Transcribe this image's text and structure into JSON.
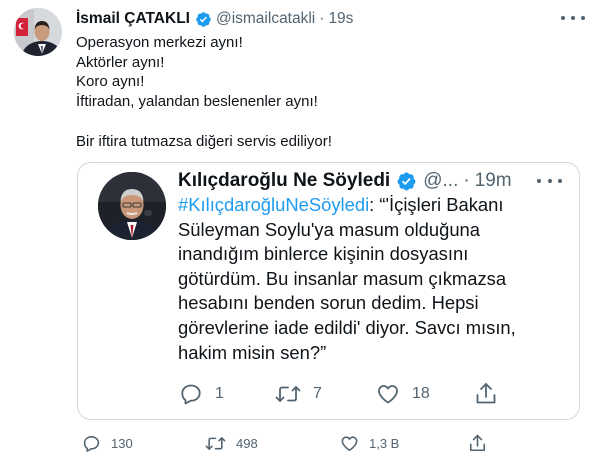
{
  "tweet": {
    "author": {
      "name": "İsmail ÇATAKLI",
      "handle": "@ismailcatakli",
      "verified": true
    },
    "time": "19s",
    "separator": "·",
    "lines": [
      "Operasyon merkezi aynı!",
      "Aktörler aynı!",
      "Koro aynı!",
      "İftiradan, yalandan beslenenler aynı!",
      "",
      "Bir iftira tutmazsa diğeri servis ediliyor!"
    ],
    "stats": {
      "replies": "130",
      "retweets": "498",
      "likes": "1,3 B"
    }
  },
  "quoted": {
    "author": {
      "name": "Kılıçdaroğlu Ne Söyledi",
      "handle": "@...",
      "verified": true
    },
    "time": "19m",
    "separator": "·",
    "hashtag": "#KılıçdaroğluNeSöyledi",
    "first_line_rest": ": “'İçişleri Bakanı",
    "lines": [
      "Süleyman Soylu'ya masum olduğuna",
      "inandığım binlerce kişinin dosyasını",
      "götürdüm. Bu insanlar masum çıkmazsa",
      "hesabını benden sorun dedim. Hepsi",
      "görevlerine iade edildi' diyor. Savcı mısın,",
      "hakim misin sen?”"
    ],
    "stats": {
      "replies": "1",
      "retweets": "7",
      "likes": "18"
    }
  },
  "icons": {
    "avatar": "profile-photo-man-with-flag",
    "verified": "verified-badge-icon",
    "more": "more-dots-icon",
    "reply": "reply-icon",
    "retweet": "retweet-icon",
    "like": "heart-icon",
    "share": "share-icon"
  },
  "colors": {
    "text": "#0f1419",
    "secondary": "#536471",
    "accent": "#1d9bf0",
    "border": "#cfd9de"
  }
}
